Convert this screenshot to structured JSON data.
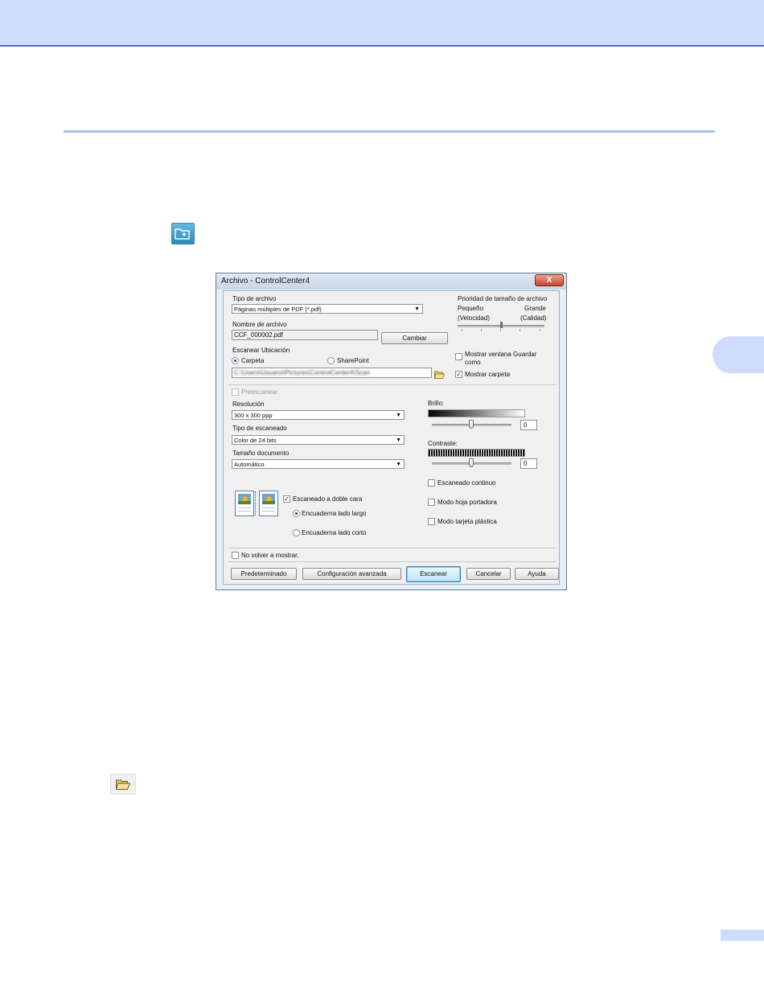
{
  "dialog": {
    "title": "Archivo - ControlCenter4",
    "close_label": "X",
    "file_type": {
      "label": "Tipo de archivo",
      "value": "Páginas múltiples de PDF (*.pdf)"
    },
    "file_name": {
      "label": "Nombre de archivo",
      "value": "CCF_000002.pdf",
      "change_button": "Cambiar"
    },
    "file_size_priority": {
      "title": "Prioridad de tamaño de archivo",
      "small_label": "Pequeño",
      "small_sub": "(Velocidad)",
      "large_label": "Grande",
      "large_sub": "(Calidad)",
      "level": 0.5
    },
    "scan_location": {
      "label": "Escanear Ubicación",
      "folder_option": "Carpeta",
      "sharepoint_option": "SharePoint",
      "selected": "Carpeta",
      "path": "C:\\Users\\Usuario\\Pictures\\ControlCenter4\\Scan"
    },
    "show_save_window": {
      "label_line1": "Mostrar ventana Guardar",
      "label_line2": "como",
      "checked": false
    },
    "show_folder": {
      "label": "Mostrar carpeta",
      "checked": true
    },
    "prescan": {
      "label": "Preescanear",
      "checked": false,
      "enabled": false
    },
    "resolution": {
      "label": "Resolución",
      "value": "300 x 300 ppp"
    },
    "scan_type": {
      "label": "Tipo de escaneado",
      "value": "Color de 24 bits"
    },
    "document_size": {
      "label": "Tamaño documento",
      "value": "Automático"
    },
    "brightness": {
      "label": "Brillo:",
      "value": "0"
    },
    "contrast": {
      "label": "Contraste:",
      "value": "0"
    },
    "continuous_scan": {
      "label": "Escaneado continuo",
      "checked": false
    },
    "carrier_sheet": {
      "label": "Modo hoja portadora",
      "checked": false
    },
    "plastic_card": {
      "label": "Modo tarjeta plástica",
      "checked": false
    },
    "duplex": {
      "label": "Escaneado a doble cara",
      "checked": true,
      "long_edge": "Encuaderna lado largo",
      "short_edge": "Encuaderna lado corto",
      "selected": "Encuaderna lado largo"
    },
    "dont_show_again": {
      "label": "No volver a mostrar.",
      "checked": false
    },
    "buttons": {
      "default": "Predeterminado",
      "advanced": "Configuración avanzada",
      "scan": "Escanear",
      "cancel": "Cancelar",
      "help": "Ayuda"
    }
  },
  "icons": {
    "app_icon": "scan-to-file-icon",
    "folder_button_icon": "open-folder-icon"
  },
  "colors": {
    "header_band": "#cddcfb",
    "accent_line": "#4a74c9",
    "section_rule": "#a9c1ef"
  }
}
